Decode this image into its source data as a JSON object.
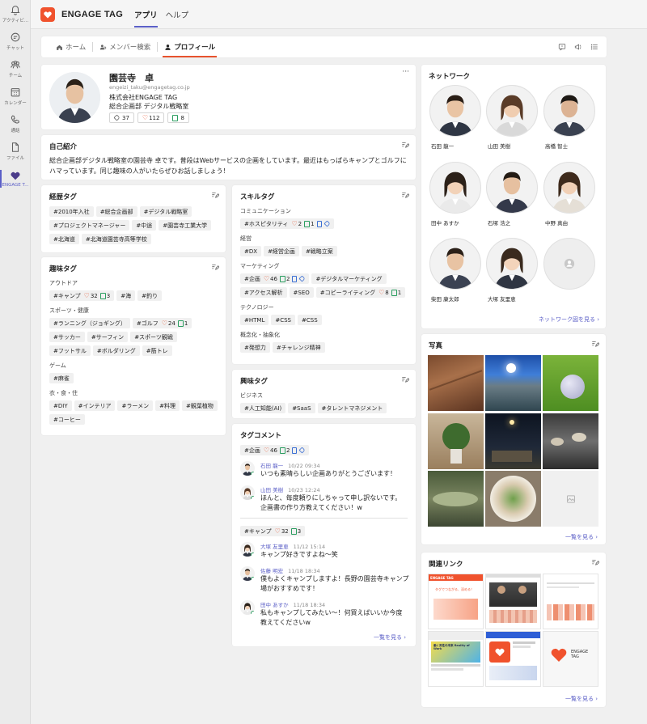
{
  "rail": [
    {
      "label": "アクティビ...",
      "icon": "bell-icon"
    },
    {
      "label": "チャット",
      "icon": "chat-icon"
    },
    {
      "label": "チーム",
      "icon": "teams-icon"
    },
    {
      "label": "カレンダー",
      "icon": "calendar-icon"
    },
    {
      "label": "通話",
      "icon": "phone-icon"
    },
    {
      "label": "ファイル",
      "icon": "file-icon"
    },
    {
      "label": "ENGAGE T...",
      "icon": "engage-heart-icon"
    }
  ],
  "header": {
    "title": "ENGAGE TAG",
    "tabs": [
      "アプリ",
      "ヘルプ"
    ]
  },
  "subnav": {
    "items": [
      "ホーム",
      "メンバー検索",
      "プロフィール"
    ]
  },
  "profile": {
    "name": "園芸寺　卓",
    "email": "engeizi_taku@engagetag.co.jp",
    "company": "株式会社ENGAGE TAG",
    "dept": "総合企画部 デジタル戦略室",
    "stats": {
      "tags": "37",
      "likes": "112",
      "notes": "8"
    },
    "more": "···"
  },
  "intro": {
    "title": "自己紹介",
    "text": "総合企画部デジタル戦略室の園芸寺 卓です。普段はWebサービスの企画をしています。最近はもっぱらキャンプとゴルフにハマっています。同じ趣味の人がいたらぜひお話しましょう！"
  },
  "career": {
    "title": "経歴タグ",
    "rows": [
      [
        "#2010年入社",
        "#総合企画部",
        "#デジタル戦略室"
      ],
      [
        "#プロジェクトマネージャー",
        "#中途",
        "#園芸寺工業大学"
      ],
      [
        "#北海道",
        "#北海道園芸寺高等学校"
      ]
    ]
  },
  "hobby": {
    "title": "趣味タグ",
    "sections": [
      {
        "label": "アウトドア",
        "tags": [
          {
            "t": "#キャンプ",
            "h": "32",
            "n": "3"
          },
          {
            "t": "#海"
          },
          {
            "t": "#釣り"
          }
        ]
      },
      {
        "label": "スポーツ・健康",
        "tags": [
          {
            "t": "#ランニング（ジョギング）"
          },
          {
            "t": "#ゴルフ",
            "h": "24",
            "n": "1"
          },
          {
            "t": "#サッカー"
          },
          {
            "t": "#サーフィン"
          },
          {
            "t": "#スポーツ観戦"
          },
          {
            "t": "#フットサル"
          },
          {
            "t": "#ボルダリング"
          },
          {
            "t": "#筋トレ"
          }
        ]
      },
      {
        "label": "ゲーム",
        "tags": [
          {
            "t": "#麻雀"
          }
        ]
      },
      {
        "label": "衣・食・住",
        "tags": [
          {
            "t": "#DIY"
          },
          {
            "t": "#インテリア"
          },
          {
            "t": "#ラーメン"
          },
          {
            "t": "#料理"
          },
          {
            "t": "#観葉植物"
          },
          {
            "t": "#コーヒー"
          }
        ]
      }
    ]
  },
  "skill": {
    "title": "スキルタグ",
    "sections": [
      {
        "label": "コミュニケーション",
        "tags": [
          {
            "t": "#ホスピタリティ",
            "h": "2",
            "n": "1",
            "d": true,
            "g": true
          }
        ]
      },
      {
        "label": "経営",
        "tags": [
          {
            "t": "#DX"
          },
          {
            "t": "#経営企画"
          },
          {
            "t": "#戦略立案"
          }
        ]
      },
      {
        "label": "マーケティング",
        "tags": [
          {
            "t": "#企画",
            "h": "46",
            "n": "2",
            "d": true,
            "g": true
          },
          {
            "t": "#デジタルマーケティング"
          },
          {
            "t": "#アクセス解析"
          },
          {
            "t": "#SEO"
          },
          {
            "t": "#コピーライティング",
            "h": "8",
            "n": "1"
          }
        ]
      },
      {
        "label": "テクノロジー",
        "tags": [
          {
            "t": "#HTML"
          },
          {
            "t": "#CSS"
          },
          {
            "t": "#CSS"
          }
        ]
      },
      {
        "label": "概念化・抽象化",
        "tags": [
          {
            "t": "#発想力"
          },
          {
            "t": "#チャレンジ精神"
          }
        ]
      }
    ]
  },
  "interest": {
    "title": "興味タグ",
    "sections": [
      {
        "label": "ビジネス",
        "tags": [
          {
            "t": "#人工知能(AI)"
          },
          {
            "t": "#SaaS"
          },
          {
            "t": "#タレントマネジメント"
          }
        ]
      }
    ]
  },
  "comments": {
    "title": "タグコメント",
    "groups": [
      {
        "tag": {
          "t": "#企画",
          "h": "46",
          "n": "2",
          "d": true,
          "g": true
        },
        "items": [
          {
            "name": "石田 龍一",
            "time": "10/22 09:34",
            "text": [
              "いつも素晴らしい企画ありがとうございます！"
            ]
          },
          {
            "name": "山田 美樹",
            "time": "10/23 12:24",
            "text": [
              "ほんと、毎度頼りにしちゃって申し訳ないです。",
              "企画書の作り方教えてください！w"
            ]
          }
        ]
      },
      {
        "tag": {
          "t": "#キャンプ",
          "h": "32",
          "n": "3"
        },
        "items": [
          {
            "name": "大塚 友里恵",
            "time": "11/12 15:14",
            "text": [
              "キャンプ好きですよね〜笑"
            ]
          },
          {
            "name": "佐藤 明宏",
            "time": "11/18 18:34",
            "text": [
              "僕もよくキャンプしますよ！長野の園芸寺キャンプ",
              "場がおすすめです！"
            ]
          },
          {
            "name": "田中 あすか",
            "time": "11/18 18:34",
            "text": [
              "私もキャンプしてみたい〜！何買えばいいか今度",
              "教えてくださいw"
            ]
          }
        ]
      }
    ],
    "more": "一覧を見る"
  },
  "network": {
    "title": "ネットワーク",
    "people": [
      "石田 龍一",
      "山田 美樹",
      "高橋 智士",
      "田中 あすか",
      "石塚 浩之",
      "中野 真由",
      "柴田 康太郎",
      "大塚 友里恵"
    ],
    "more": "ネットワーク図を見る"
  },
  "photos": {
    "title": "写真",
    "more": "一覧を見る"
  },
  "links": {
    "title": "関連リンク",
    "more": "一覧を見る",
    "thumb1": "ENGAGE TAG",
    "thumb1_text": "タグでつながる、深める！",
    "thumb3_text": "働く男性の未来 Reality of Work",
    "thumb4_text": "ENGAGE TAG"
  },
  "colors": {
    "accent": "#5b5fc7",
    "brand": "#f0522d",
    "heart": "#e8532e",
    "note": "#2a9d5f"
  }
}
